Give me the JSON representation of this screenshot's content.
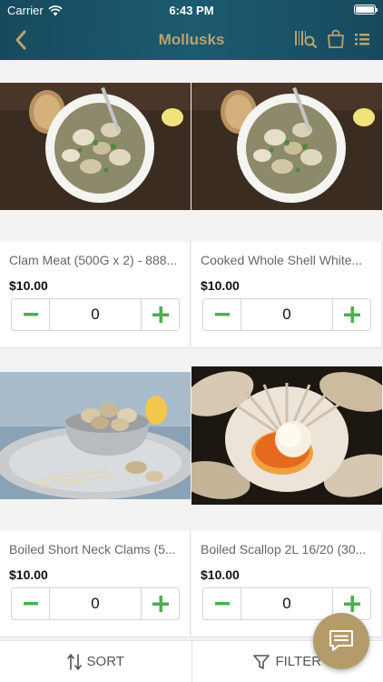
{
  "status_bar": {
    "carrier": "Carrier",
    "time": "6:43 PM"
  },
  "nav": {
    "title": "Mollusks"
  },
  "products": [
    {
      "name": "Clam Meat (500G x 2) - 888...",
      "price": "$10.00",
      "quantity": "0",
      "image": "clams-bowl-image"
    },
    {
      "name": "Cooked Whole Shell White...",
      "price": "$10.00",
      "quantity": "0",
      "image": "clams-bowl-image"
    },
    {
      "name": "Boiled Short Neck Clams (5...",
      "price": "$10.00",
      "quantity": "0",
      "image": "clams-tray-image"
    },
    {
      "name": "Boiled Scallop 2L 16/20 (30...",
      "price": "$10.00",
      "quantity": "0",
      "image": "scallop-image"
    }
  ],
  "bottom_bar": {
    "sort_label": "SORT",
    "filter_label": "FILTER"
  },
  "colors": {
    "header": "#174a5e",
    "title": "#b9a26e",
    "accent_green": "#4caf50",
    "fab": "#b39c6a"
  }
}
